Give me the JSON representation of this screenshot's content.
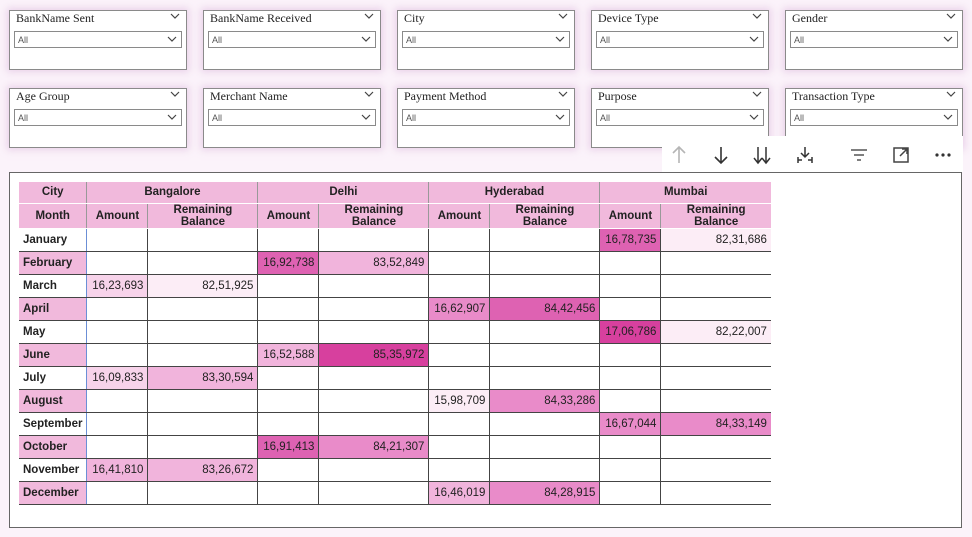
{
  "slicers_row1": [
    {
      "title": "BankName Sent",
      "value": "All"
    },
    {
      "title": "BankName Received",
      "value": "All"
    },
    {
      "title": "City",
      "value": "All"
    },
    {
      "title": "Device Type",
      "value": "All"
    },
    {
      "title": "Gender",
      "value": "All"
    }
  ],
  "slicers_row2": [
    {
      "title": "Age Group",
      "value": "All"
    },
    {
      "title": "Merchant Name",
      "value": "All"
    },
    {
      "title": "Payment Method",
      "value": "All"
    },
    {
      "title": "Purpose",
      "value": "All"
    },
    {
      "title": "Transaction Type",
      "value": "All"
    }
  ],
  "toolbar": {
    "icons": [
      "arrow-up-icon",
      "arrow-down-icon",
      "double-arrow-down-icon",
      "expand-hierarchy-icon",
      "filter-icon",
      "focus-mode-icon",
      "more-options-icon"
    ]
  },
  "matrix": {
    "corner_top": "City",
    "corner_bottom": "Month",
    "cities": [
      "Bangalore",
      "Delhi",
      "Hyderabad",
      "Mumbai"
    ],
    "measure_amount": "Amount",
    "measure_balance": "Remaining Balance",
    "rows": [
      {
        "month": "January",
        "values": [
          "",
          "",
          "",
          "",
          "",
          "",
          "16,78,735",
          "82,31,686"
        ]
      },
      {
        "month": "February",
        "values": [
          "",
          "",
          "16,92,738",
          "83,52,849",
          "",
          "",
          "",
          ""
        ]
      },
      {
        "month": "March",
        "values": [
          "16,23,693",
          "82,51,925",
          "",
          "",
          "",
          "",
          "",
          ""
        ]
      },
      {
        "month": "April",
        "values": [
          "",
          "",
          "",
          "",
          "16,62,907",
          "84,42,456",
          "",
          ""
        ]
      },
      {
        "month": "May",
        "values": [
          "",
          "",
          "",
          "",
          "",
          "",
          "17,06,786",
          "82,22,007"
        ]
      },
      {
        "month": "June",
        "values": [
          "",
          "",
          "16,52,588",
          "85,35,972",
          "",
          "",
          "",
          ""
        ]
      },
      {
        "month": "July",
        "values": [
          "16,09,833",
          "83,30,594",
          "",
          "",
          "",
          "",
          "",
          ""
        ]
      },
      {
        "month": "August",
        "values": [
          "",
          "",
          "",
          "",
          "15,98,709",
          "84,33,286",
          "",
          ""
        ]
      },
      {
        "month": "September",
        "values": [
          "",
          "",
          "",
          "",
          "",
          "",
          "16,67,044",
          "84,33,149"
        ]
      },
      {
        "month": "October",
        "values": [
          "",
          "",
          "16,91,413",
          "84,21,307",
          "",
          "",
          "",
          ""
        ]
      },
      {
        "month": "November",
        "values": [
          "16,41,810",
          "83,26,672",
          "",
          "",
          "",
          "",
          "",
          ""
        ]
      },
      {
        "month": "December",
        "values": [
          "",
          "",
          "",
          "",
          "16,46,019",
          "84,28,915",
          "",
          ""
        ]
      }
    ],
    "heat_colors": [
      "#d7409e",
      "#de62b2",
      "#e98bc9",
      "#f1b4dc",
      "#f7d3ea",
      "#fcedf6"
    ]
  }
}
